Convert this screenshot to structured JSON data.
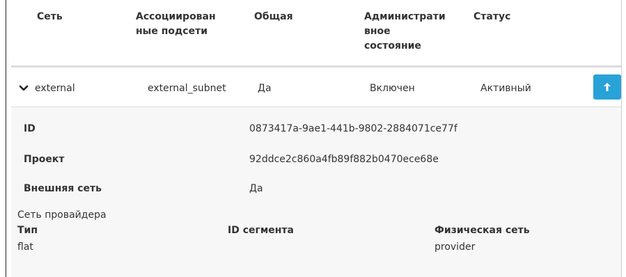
{
  "table": {
    "headers": {
      "network": "Сеть",
      "subnets": [
        "Ассоциирован",
        "ные подсети"
      ],
      "shared": "Общая",
      "admin_state": [
        "Администрати",
        "вное",
        "состояние"
      ],
      "status": "Статус"
    },
    "row": {
      "name": "external",
      "subnet": "external_subnet",
      "shared": "Да",
      "admin_state": "Включен",
      "status": "Активный",
      "collapse_icon": "chevron-down-icon",
      "action_icon": "arrow-up-icon"
    }
  },
  "details": {
    "id_label": "ID",
    "id_value": "0873417a-9ae1-441b-9802-2884071ce77f",
    "project_label": "Проект",
    "project_value": "92ddce2c860a4fb89f882b0470ece68e",
    "external_label": "Внешняя сеть",
    "external_value": "Да",
    "provider_section": "Сеть провайдера",
    "type_label": "Тип",
    "type_value": "flat",
    "segment_label": "ID сегмента",
    "physnet_label": "Физическая сеть",
    "physnet_value": "provider"
  },
  "colors": {
    "accent": "#29a2d8",
    "detail_bg": "#f7f7f7",
    "border": "#dddddd"
  }
}
